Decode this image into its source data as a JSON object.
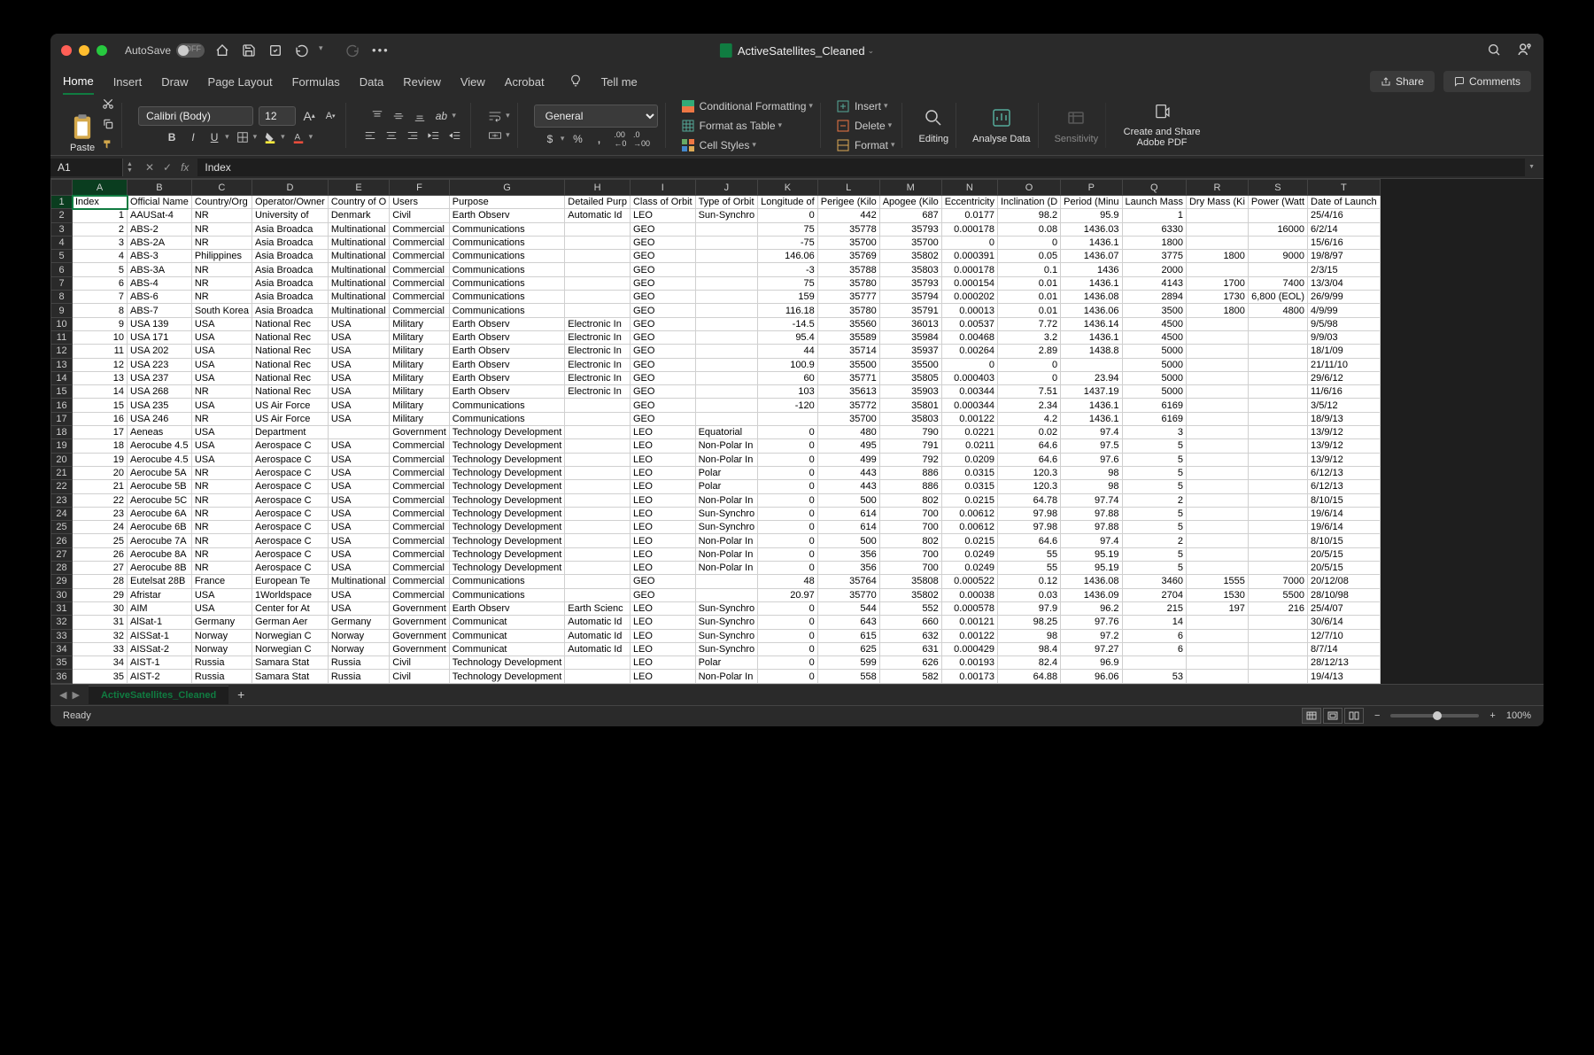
{
  "titlebar": {
    "autosave_label": "AutoSave",
    "autosave_state": "OFF",
    "filename": "ActiveSatellites_Cleaned"
  },
  "ribbon_tabs": [
    "Home",
    "Insert",
    "Draw",
    "Page Layout",
    "Formulas",
    "Data",
    "Review",
    "View",
    "Acrobat"
  ],
  "tellme": "Tell me",
  "share": "Share",
  "comments": "Comments",
  "ribbon": {
    "paste": "Paste",
    "font_name": "Calibri (Body)",
    "font_size": "12",
    "number_format": "General",
    "cond_fmt": "Conditional Formatting",
    "fmt_table": "Format as Table",
    "cell_styles": "Cell Styles",
    "insert": "Insert",
    "delete": "Delete",
    "format": "Format",
    "editing": "Editing",
    "analyse": "Analyse Data",
    "sensitivity": "Sensitivity",
    "create_pdf": "Create and Share Adobe PDF"
  },
  "formula": {
    "cell_ref": "A1",
    "value": "Index"
  },
  "columns": [
    "A",
    "B",
    "C",
    "D",
    "E",
    "F",
    "G",
    "H",
    "I",
    "J",
    "K",
    "L",
    "M",
    "N",
    "O",
    "P",
    "Q",
    "R",
    "S",
    "T"
  ],
  "headers": [
    "Index",
    "Official Name",
    "Country/Org",
    "Operator/Owner",
    "Country of O",
    "Users",
    "Purpose",
    "Detailed Purp",
    "Class of Orbit",
    "Type of Orbit",
    "Longitude of",
    "Perigee (Kilo",
    "Apogee (Kilo",
    "Eccentricity",
    "Inclination (D",
    "Period (Minu",
    "Launch Mass",
    "Dry Mass (Ki",
    "Power (Watt",
    "Date of Launch"
  ],
  "rows": [
    [
      "1",
      "AAUSat-4",
      "NR",
      "University of",
      "Denmark",
      "Civil",
      "Earth Observ",
      "Automatic Id",
      "LEO",
      "Sun-Synchro",
      "0",
      "442",
      "687",
      "0.0177",
      "98.2",
      "95.9",
      "1",
      "",
      "",
      "25/4/16"
    ],
    [
      "2",
      "ABS-2",
      "NR",
      "Asia Broadca",
      "Multinational",
      "Commercial",
      "Communications",
      "",
      "GEO",
      "",
      "75",
      "35778",
      "35793",
      "0.000178",
      "0.08",
      "1436.03",
      "6330",
      "",
      "16000",
      "6/2/14"
    ],
    [
      "3",
      "ABS-2A",
      "NR",
      "Asia Broadca",
      "Multinational",
      "Commercial",
      "Communications",
      "",
      "GEO",
      "",
      "-75",
      "35700",
      "35700",
      "0",
      "0",
      "1436.1",
      "1800",
      "",
      "",
      "15/6/16"
    ],
    [
      "4",
      "ABS-3",
      "Philippines",
      "Asia Broadca",
      "Multinational",
      "Commercial",
      "Communications",
      "",
      "GEO",
      "",
      "146.06",
      "35769",
      "35802",
      "0.000391",
      "0.05",
      "1436.07",
      "3775",
      "1800",
      "9000",
      "19/8/97"
    ],
    [
      "5",
      "ABS-3A",
      "NR",
      "Asia Broadca",
      "Multinational",
      "Commercial",
      "Communications",
      "",
      "GEO",
      "",
      "-3",
      "35788",
      "35803",
      "0.000178",
      "0.1",
      "1436",
      "2000",
      "",
      "",
      "2/3/15"
    ],
    [
      "6",
      "ABS-4",
      "NR",
      "Asia Broadca",
      "Multinational",
      "Commercial",
      "Communications",
      "",
      "GEO",
      "",
      "75",
      "35780",
      "35793",
      "0.000154",
      "0.01",
      "1436.1",
      "4143",
      "1700",
      "7400",
      "13/3/04"
    ],
    [
      "7",
      "ABS-6",
      "NR",
      "Asia Broadca",
      "Multinational",
      "Commercial",
      "Communications",
      "",
      "GEO",
      "",
      "159",
      "35777",
      "35794",
      "0.000202",
      "0.01",
      "1436.08",
      "2894",
      "1730",
      "6,800 (EOL)",
      "26/9/99"
    ],
    [
      "8",
      "ABS-7",
      "South Korea",
      "Asia Broadca",
      "Multinational",
      "Commercial",
      "Communications",
      "",
      "GEO",
      "",
      "116.18",
      "35780",
      "35791",
      "0.00013",
      "0.01",
      "1436.06",
      "3500",
      "1800",
      "4800",
      "4/9/99"
    ],
    [
      "9",
      "USA 139",
      "USA",
      "National Rec",
      "USA",
      "Military",
      "Earth Observ",
      "Electronic In",
      "GEO",
      "",
      "-14.5",
      "35560",
      "36013",
      "0.00537",
      "7.72",
      "1436.14",
      "4500",
      "",
      "",
      "9/5/98"
    ],
    [
      "10",
      "USA 171",
      "USA",
      "National Rec",
      "USA",
      "Military",
      "Earth Observ",
      "Electronic In",
      "GEO",
      "",
      "95.4",
      "35589",
      "35984",
      "0.00468",
      "3.2",
      "1436.1",
      "4500",
      "",
      "",
      "9/9/03"
    ],
    [
      "11",
      "USA 202",
      "USA",
      "National Rec",
      "USA",
      "Military",
      "Earth Observ",
      "Electronic In",
      "GEO",
      "",
      "44",
      "35714",
      "35937",
      "0.00264",
      "2.89",
      "1438.8",
      "5000",
      "",
      "",
      "18/1/09"
    ],
    [
      "12",
      "USA 223",
      "USA",
      "National Rec",
      "USA",
      "Military",
      "Earth Observ",
      "Electronic In",
      "GEO",
      "",
      "100.9",
      "35500",
      "35500",
      "0",
      "0",
      "",
      "5000",
      "",
      "",
      "21/11/10"
    ],
    [
      "13",
      "USA 237",
      "USA",
      "National Rec",
      "USA",
      "Military",
      "Earth Observ",
      "Electronic In",
      "GEO",
      "",
      "60",
      "35771",
      "35805",
      "0.000403",
      "0",
      "23.94",
      "5000",
      "",
      "",
      "29/6/12"
    ],
    [
      "14",
      "USA 268",
      "NR",
      "National Rec",
      "USA",
      "Military",
      "Earth Observ",
      "Electronic In",
      "GEO",
      "",
      "103",
      "35613",
      "35903",
      "0.00344",
      "7.51",
      "1437.19",
      "5000",
      "",
      "",
      "11/6/16"
    ],
    [
      "15",
      "USA 235",
      "USA",
      "US Air Force",
      "USA",
      "Military",
      "Communications",
      "",
      "GEO",
      "",
      "-120",
      "35772",
      "35801",
      "0.000344",
      "2.34",
      "1436.1",
      "6169",
      "",
      "",
      "3/5/12"
    ],
    [
      "16",
      "USA 246",
      "NR",
      "US Air Force",
      "USA",
      "Military",
      "Communications",
      "",
      "GEO",
      "",
      "",
      "35700",
      "35803",
      "0.00122",
      "4.2",
      "1436.1",
      "6169",
      "",
      "",
      "18/9/13"
    ],
    [
      "17",
      "Aeneas",
      "USA",
      "Department",
      "",
      "Government",
      "Technology Development",
      "",
      "LEO",
      "Equatorial",
      "0",
      "480",
      "790",
      "0.0221",
      "0.02",
      "97.4",
      "3",
      "",
      "",
      "13/9/12"
    ],
    [
      "18",
      "Aerocube 4.5",
      "USA",
      "Aerospace C",
      "USA",
      "Commercial",
      "Technology Development",
      "",
      "LEO",
      "Non-Polar In",
      "0",
      "495",
      "791",
      "0.0211",
      "64.6",
      "97.5",
      "5",
      "",
      "",
      "13/9/12"
    ],
    [
      "19",
      "Aerocube 4.5",
      "USA",
      "Aerospace C",
      "USA",
      "Commercial",
      "Technology Development",
      "",
      "LEO",
      "Non-Polar In",
      "0",
      "499",
      "792",
      "0.0209",
      "64.6",
      "97.6",
      "5",
      "",
      "",
      "13/9/12"
    ],
    [
      "20",
      "Aerocube 5A",
      "NR",
      "Aerospace C",
      "USA",
      "Commercial",
      "Technology Development",
      "",
      "LEO",
      "Polar",
      "0",
      "443",
      "886",
      "0.0315",
      "120.3",
      "98",
      "5",
      "",
      "",
      "6/12/13"
    ],
    [
      "21",
      "Aerocube 5B",
      "NR",
      "Aerospace C",
      "USA",
      "Commercial",
      "Technology Development",
      "",
      "LEO",
      "Polar",
      "0",
      "443",
      "886",
      "0.0315",
      "120.3",
      "98",
      "5",
      "",
      "",
      "6/12/13"
    ],
    [
      "22",
      "Aerocube 5C",
      "NR",
      "Aerospace C",
      "USA",
      "Commercial",
      "Technology Development",
      "",
      "LEO",
      "Non-Polar In",
      "0",
      "500",
      "802",
      "0.0215",
      "64.78",
      "97.74",
      "2",
      "",
      "",
      "8/10/15"
    ],
    [
      "23",
      "Aerocube 6A",
      "NR",
      "Aerospace C",
      "USA",
      "Commercial",
      "Technology Development",
      "",
      "LEO",
      "Sun-Synchro",
      "0",
      "614",
      "700",
      "0.00612",
      "97.98",
      "97.88",
      "5",
      "",
      "",
      "19/6/14"
    ],
    [
      "24",
      "Aerocube 6B",
      "NR",
      "Aerospace C",
      "USA",
      "Commercial",
      "Technology Development",
      "",
      "LEO",
      "Sun-Synchro",
      "0",
      "614",
      "700",
      "0.00612",
      "97.98",
      "97.88",
      "5",
      "",
      "",
      "19/6/14"
    ],
    [
      "25",
      "Aerocube 7A",
      "NR",
      "Aerospace C",
      "USA",
      "Commercial",
      "Technology Development",
      "",
      "LEO",
      "Non-Polar In",
      "0",
      "500",
      "802",
      "0.0215",
      "64.6",
      "97.4",
      "2",
      "",
      "",
      "8/10/15"
    ],
    [
      "26",
      "Aerocube 8A",
      "NR",
      "Aerospace C",
      "USA",
      "Commercial",
      "Technology Development",
      "",
      "LEO",
      "Non-Polar In",
      "0",
      "356",
      "700",
      "0.0249",
      "55",
      "95.19",
      "5",
      "",
      "",
      "20/5/15"
    ],
    [
      "27",
      "Aerocube 8B",
      "NR",
      "Aerospace C",
      "USA",
      "Commercial",
      "Technology Development",
      "",
      "LEO",
      "Non-Polar In",
      "0",
      "356",
      "700",
      "0.0249",
      "55",
      "95.19",
      "5",
      "",
      "",
      "20/5/15"
    ],
    [
      "28",
      "Eutelsat 28B",
      "France",
      "European Te",
      "Multinational",
      "Commercial",
      "Communications",
      "",
      "GEO",
      "",
      "48",
      "35764",
      "35808",
      "0.000522",
      "0.12",
      "1436.08",
      "3460",
      "1555",
      "7000",
      "20/12/08"
    ],
    [
      "29",
      "Afristar",
      "USA",
      "1Worldspace",
      "USA",
      "Commercial",
      "Communications",
      "",
      "GEO",
      "",
      "20.97",
      "35770",
      "35802",
      "0.00038",
      "0.03",
      "1436.09",
      "2704",
      "1530",
      "5500",
      "28/10/98"
    ],
    [
      "30",
      "AIM",
      "USA",
      "Center for At",
      "USA",
      "Government",
      "Earth Observ",
      "Earth Scienc",
      "LEO",
      "Sun-Synchro",
      "0",
      "544",
      "552",
      "0.000578",
      "97.9",
      "96.2",
      "215",
      "197",
      "216",
      "25/4/07"
    ],
    [
      "31",
      "AlSat-1",
      "Germany",
      "German Aer",
      "Germany",
      "Government",
      "Communicat",
      "Automatic Id",
      "LEO",
      "Sun-Synchro",
      "0",
      "643",
      "660",
      "0.00121",
      "98.25",
      "97.76",
      "14",
      "",
      "",
      "30/6/14"
    ],
    [
      "32",
      "AISSat-1",
      "Norway",
      "Norwegian C",
      "Norway",
      "Government",
      "Communicat",
      "Automatic Id",
      "LEO",
      "Sun-Synchro",
      "0",
      "615",
      "632",
      "0.00122",
      "98",
      "97.2",
      "6",
      "",
      "",
      "12/7/10"
    ],
    [
      "33",
      "AISSat-2",
      "Norway",
      "Norwegian C",
      "Norway",
      "Government",
      "Communicat",
      "Automatic Id",
      "LEO",
      "Sun-Synchro",
      "0",
      "625",
      "631",
      "0.000429",
      "98.4",
      "97.27",
      "6",
      "",
      "",
      "8/7/14"
    ],
    [
      "34",
      "AIST-1",
      "Russia",
      "Samara Stat",
      "Russia",
      "Civil",
      "Technology Development",
      "",
      "LEO",
      "Polar",
      "0",
      "599",
      "626",
      "0.00193",
      "82.4",
      "96.9",
      "",
      "",
      "",
      "28/12/13"
    ],
    [
      "35",
      "AIST-2",
      "Russia",
      "Samara Stat",
      "Russia",
      "Civil",
      "Technology Development",
      "",
      "LEO",
      "Non-Polar In",
      "0",
      "558",
      "582",
      "0.00173",
      "64.88",
      "96.06",
      "53",
      "",
      "",
      "19/4/13"
    ]
  ],
  "sheet_tab": "ActiveSatellites_Cleaned",
  "status": "Ready",
  "zoom": "100%"
}
